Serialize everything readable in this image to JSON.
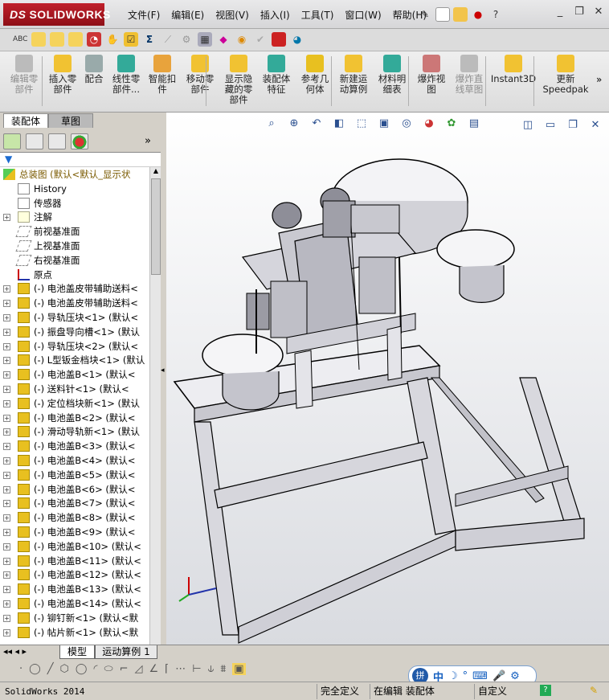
{
  "app": {
    "logo_text": "SOLIDWORKS",
    "logo_ds": "DS"
  },
  "menu": [
    "文件(F)",
    "编辑(E)",
    "视图(V)",
    "插入(I)",
    "工具(T)",
    "窗口(W)",
    "帮助(H)"
  ],
  "command_manager": [
    {
      "label": "编辑零\n部件",
      "disabled": true
    },
    {
      "label": "插入零\n部件",
      "disabled": false
    },
    {
      "label": "配合",
      "disabled": false
    },
    {
      "label": "线性零\n部件...",
      "disabled": false
    },
    {
      "label": "智能扣\n件",
      "disabled": false
    },
    {
      "label": "移动零\n部件",
      "disabled": false
    },
    {
      "label": "显示隐\n藏的零\n部件",
      "disabled": false
    },
    {
      "label": "装配体\n特征",
      "disabled": false
    },
    {
      "label": "参考几\n何体",
      "disabled": false
    },
    {
      "label": "新建运\n动算例",
      "disabled": false
    },
    {
      "label": "材料明\n细表",
      "disabled": false
    },
    {
      "label": "爆炸视\n图",
      "disabled": false
    },
    {
      "label": "爆炸直\n线草图",
      "disabled": true
    },
    {
      "label": "Instant3D",
      "disabled": false
    },
    {
      "label": "更新\nSpeedpak",
      "disabled": false
    }
  ],
  "panel_tabs": [
    "装配体",
    "草图"
  ],
  "tree": [
    {
      "label": "总装图  (默认<默认_显示状",
      "kind": "root",
      "expand": ""
    },
    {
      "label": "History",
      "kind": "history",
      "expand": ""
    },
    {
      "label": "传感器",
      "kind": "sensor",
      "expand": ""
    },
    {
      "label": "注解",
      "kind": "note",
      "expand": "+"
    },
    {
      "label": "前视基准面",
      "kind": "plane",
      "expand": ""
    },
    {
      "label": "上视基准面",
      "kind": "plane",
      "expand": ""
    },
    {
      "label": "右视基准面",
      "kind": "plane",
      "expand": ""
    },
    {
      "label": "原点",
      "kind": "origin",
      "expand": ""
    },
    {
      "label": "(-) 电池盖皮带辅助送料<",
      "kind": "part",
      "expand": "+"
    },
    {
      "label": "(-) 电池盖皮带辅助送料<",
      "kind": "part",
      "expand": "+"
    },
    {
      "label": "(-) 导轨压块<1> (默认<",
      "kind": "part",
      "expand": "+"
    },
    {
      "label": "(-) 振盘导向槽<1> (默认",
      "kind": "part",
      "expand": "+"
    },
    {
      "label": "(-) 导轨压块<2> (默认<",
      "kind": "part",
      "expand": "+"
    },
    {
      "label": "(-) L型钣金档块<1> (默认",
      "kind": "part",
      "expand": "+"
    },
    {
      "label": "(-) 电池盖B<1> (默认<",
      "kind": "part",
      "expand": "+"
    },
    {
      "label": "(-) 送料针<1> (默认<",
      "kind": "part",
      "expand": "+"
    },
    {
      "label": "(-) 定位档块新<1> (默认",
      "kind": "part",
      "expand": "+"
    },
    {
      "label": "(-) 电池盖B<2> (默认<",
      "kind": "part",
      "expand": "+"
    },
    {
      "label": "(-) 滑动导轨新<1> (默认",
      "kind": "part",
      "expand": "+"
    },
    {
      "label": "(-) 电池盖B<3> (默认<",
      "kind": "part",
      "expand": "+"
    },
    {
      "label": "(-) 电池盖B<4> (默认<",
      "kind": "part",
      "expand": "+"
    },
    {
      "label": "(-) 电池盖B<5> (默认<",
      "kind": "part",
      "expand": "+"
    },
    {
      "label": "(-) 电池盖B<6> (默认<",
      "kind": "part",
      "expand": "+"
    },
    {
      "label": "(-) 电池盖B<7> (默认<",
      "kind": "part",
      "expand": "+"
    },
    {
      "label": "(-) 电池盖B<8> (默认<",
      "kind": "part",
      "expand": "+"
    },
    {
      "label": "(-) 电池盖B<9> (默认<",
      "kind": "part",
      "expand": "+"
    },
    {
      "label": "(-) 电池盖B<10> (默认<",
      "kind": "part",
      "expand": "+"
    },
    {
      "label": "(-) 电池盖B<11> (默认<",
      "kind": "part",
      "expand": "+"
    },
    {
      "label": "(-) 电池盖B<12> (默认<",
      "kind": "part",
      "expand": "+"
    },
    {
      "label": "(-) 电池盖B<13> (默认<",
      "kind": "part",
      "expand": "+"
    },
    {
      "label": "(-) 电池盖B<14> (默认<",
      "kind": "part",
      "expand": "+"
    },
    {
      "label": "(-) 铆钉新<1> (默认<默",
      "kind": "part",
      "expand": "+"
    },
    {
      "label": "(-) 帖片新<1> (默认<默",
      "kind": "part",
      "expand": "+"
    }
  ],
  "bottom_tabs": [
    "模型",
    "运动算例 1"
  ],
  "status": {
    "app_version": "SolidWorks 2014",
    "definition": "完全定义",
    "editing": "在编辑 装配体",
    "custom": "自定义"
  },
  "ime": {
    "mode": "中"
  },
  "colors": {
    "part_icon": "#e8c020",
    "accent": "#2a4f8f",
    "viewport_bg": "#ffffff"
  }
}
